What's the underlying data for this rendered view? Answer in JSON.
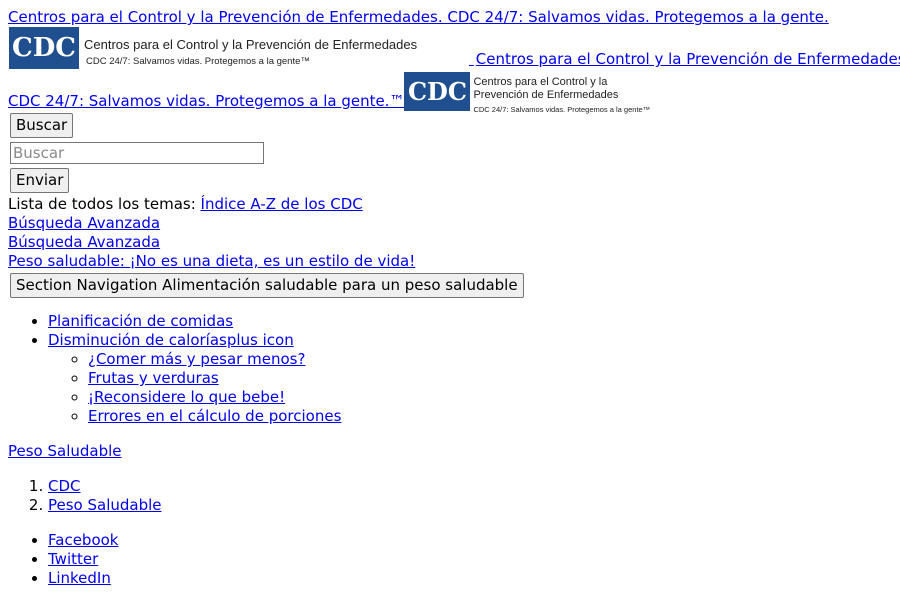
{
  "header": {
    "skip_link_top": "Centros para el Control y la Prevención de Enfermedades. CDC 24/7: Salvamos vidas. Protegemos a la gente.",
    "logo_big": {
      "mark": "CDC",
      "line1": "Centros para el Control y la Prevención de Enfermedades",
      "line2": "CDC 24/7: Salvamos vidas. Protegemos a la gente™"
    },
    "logo_link_text_a": "Centros para el Control y la Prevención de Enfermedades.",
    "logo_link_text_b": "CDC 24/7: Salvamos vidas. Protegemos a la gente.™",
    "logo_small": {
      "mark": "CDC",
      "line1": "Centros para el Control y la",
      "line2": "Prevención de Enfermedades",
      "line3": "CDC 24/7: Salvamos vidas. Protegemos a la gente™"
    },
    "colors": {
      "link": "#0000ee",
      "logo_blue": "#1f4f8f"
    }
  },
  "search": {
    "search_button": "Buscar",
    "placeholder": "Buscar",
    "value": "",
    "submit_button": "Enviar",
    "topics_label": "Lista de todos los temas:",
    "topics_link": "Índice A-Z de los CDC",
    "advanced_1": "Búsqueda Avanzada",
    "advanced_2": "Búsqueda Avanzada"
  },
  "site_title_link": "Peso saludable: ¡No es una dieta, es un estilo de vida!",
  "section_nav_button": "Section Navigation Alimentación saludable para un peso saludable",
  "nav": {
    "items": [
      {
        "label": "Planificación de comidas"
      },
      {
        "label": "Disminución de caloríasplus icon"
      }
    ],
    "subitems": [
      {
        "label": "¿Comer más y pesar menos?"
      },
      {
        "label": "Frutas y verduras"
      },
      {
        "label": "¡Reconsidere lo que bebe!"
      },
      {
        "label": "Errores en el cálculo de porciones"
      }
    ]
  },
  "section_link": "Peso Saludable",
  "breadcrumb": [
    "CDC",
    "Peso Saludable"
  ],
  "social": [
    "Facebook",
    "Twitter",
    "LinkedIn"
  ]
}
